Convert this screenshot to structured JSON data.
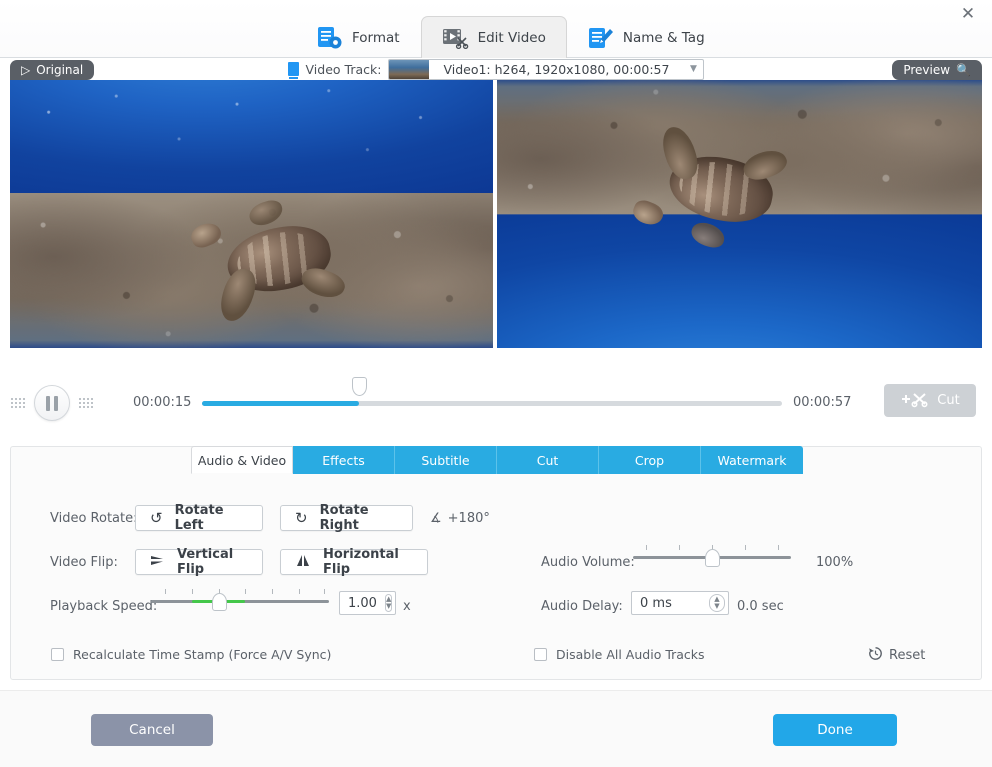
{
  "window": {
    "close_icon": "close-icon"
  },
  "top_tabs": [
    {
      "label": "Format",
      "icon": "document-gear-icon",
      "active": false
    },
    {
      "label": "Edit Video",
      "icon": "film-scissors-icon",
      "active": true
    },
    {
      "label": "Name & Tag",
      "icon": "document-pencil-icon",
      "active": false
    }
  ],
  "track": {
    "label": "Video Track:",
    "icon": "video-track-icon",
    "selected": "Video1: h264, 1920x1080, 00:00:57",
    "caret_icon": "chevron-down-icon"
  },
  "preview": {
    "original_badge": "Original",
    "original_icon": "play-triangle-icon",
    "preview_badge": "Preview",
    "preview_icon": "magnifier-icon"
  },
  "transport": {
    "play_state_icon": "pause-icon",
    "grip_icon": "grip-dots-icon",
    "current_time": "00:00:15",
    "total_time": "00:00:57",
    "progress_percent": 27,
    "cut_label": "Cut",
    "cut_icon": "add-scissors-icon"
  },
  "sub_tabs": [
    {
      "label": "Audio & Video",
      "active": true
    },
    {
      "label": "Effects",
      "active": false
    },
    {
      "label": "Subtitle",
      "active": false
    },
    {
      "label": "Cut",
      "active": false
    },
    {
      "label": "Crop",
      "active": false
    },
    {
      "label": "Watermark",
      "active": false
    }
  ],
  "audio_video": {
    "rotate_label": "Video Rotate:",
    "rotate_left": "Rotate Left",
    "rotate_left_icon": "rotate-ccw-icon",
    "rotate_right": "Rotate Right",
    "rotate_right_icon": "rotate-cw-icon",
    "angle_icon": "angle-icon",
    "angle_value": "+180°",
    "flip_label": "Video Flip:",
    "vertical_flip": "Vertical Flip",
    "vertical_flip_icon": "vertical-flip-icon",
    "horizontal_flip": "Horizontal Flip",
    "horizontal_flip_icon": "horizontal-flip-icon",
    "speed_label": "Playback Speed:",
    "speed_value": "1.00",
    "speed_unit": "x",
    "speed_slider_percent": 38,
    "volume_label": "Audio Volume:",
    "volume_value": "100%",
    "volume_slider_percent": 50,
    "delay_label": "Audio Delay:",
    "delay_value": "0 ms",
    "delay_seconds": "0.0 sec",
    "recalculate_label": "Recalculate Time Stamp (Force A/V Sync)",
    "recalculate_checked": false,
    "disable_audio_label": "Disable All Audio Tracks",
    "disable_audio_checked": false,
    "reset_label": "Reset",
    "reset_icon": "history-reset-icon"
  },
  "footer": {
    "cancel": "Cancel",
    "done": "Done"
  },
  "colors": {
    "accent": "#29abe2",
    "green": "#44c74a",
    "cancel": "#8b93a8",
    "done": "#22a7e8"
  }
}
